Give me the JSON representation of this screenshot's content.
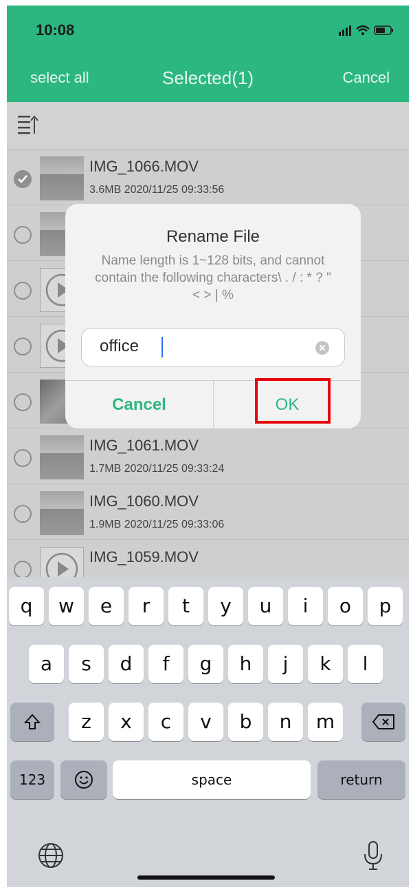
{
  "status_bar": {
    "time": "10:08"
  },
  "nav": {
    "select_all": "select all",
    "title": "Selected(1)",
    "cancel": "Cancel"
  },
  "colors": {
    "accent": "#2db780",
    "highlight": "#e8000b"
  },
  "files": [
    {
      "name": "IMG_1066.MOV",
      "meta": "3.6MB 2020/11/25 09:33:56",
      "selected": true
    },
    {
      "name": "",
      "meta": "",
      "selected": false
    },
    {
      "name": "",
      "meta": "",
      "selected": false
    },
    {
      "name": "",
      "meta": "",
      "selected": false
    },
    {
      "name": "",
      "meta": "",
      "selected": false
    },
    {
      "name": "IMG_1061.MOV",
      "meta": "1.7MB 2020/11/25 09:33:24",
      "selected": false
    },
    {
      "name": "IMG_1060.MOV",
      "meta": "1.9MB 2020/11/25 09:33:06",
      "selected": false
    },
    {
      "name": "IMG_1059.MOV",
      "meta": "",
      "selected": false
    }
  ],
  "dialog": {
    "title": "Rename File",
    "message": "Name length is 1~128 bits, and cannot contain the following characters\\ . / : * ? \" < > | %",
    "input_value": "office",
    "cancel_label": "Cancel",
    "ok_label": "OK"
  },
  "keyboard": {
    "row1": [
      "q",
      "w",
      "e",
      "r",
      "t",
      "y",
      "u",
      "i",
      "o",
      "p"
    ],
    "row2": [
      "a",
      "s",
      "d",
      "f",
      "g",
      "h",
      "j",
      "k",
      "l"
    ],
    "row3": [
      "z",
      "x",
      "c",
      "v",
      "b",
      "n",
      "m"
    ],
    "numbers_label": "123",
    "space_label": "space",
    "return_label": "return"
  }
}
